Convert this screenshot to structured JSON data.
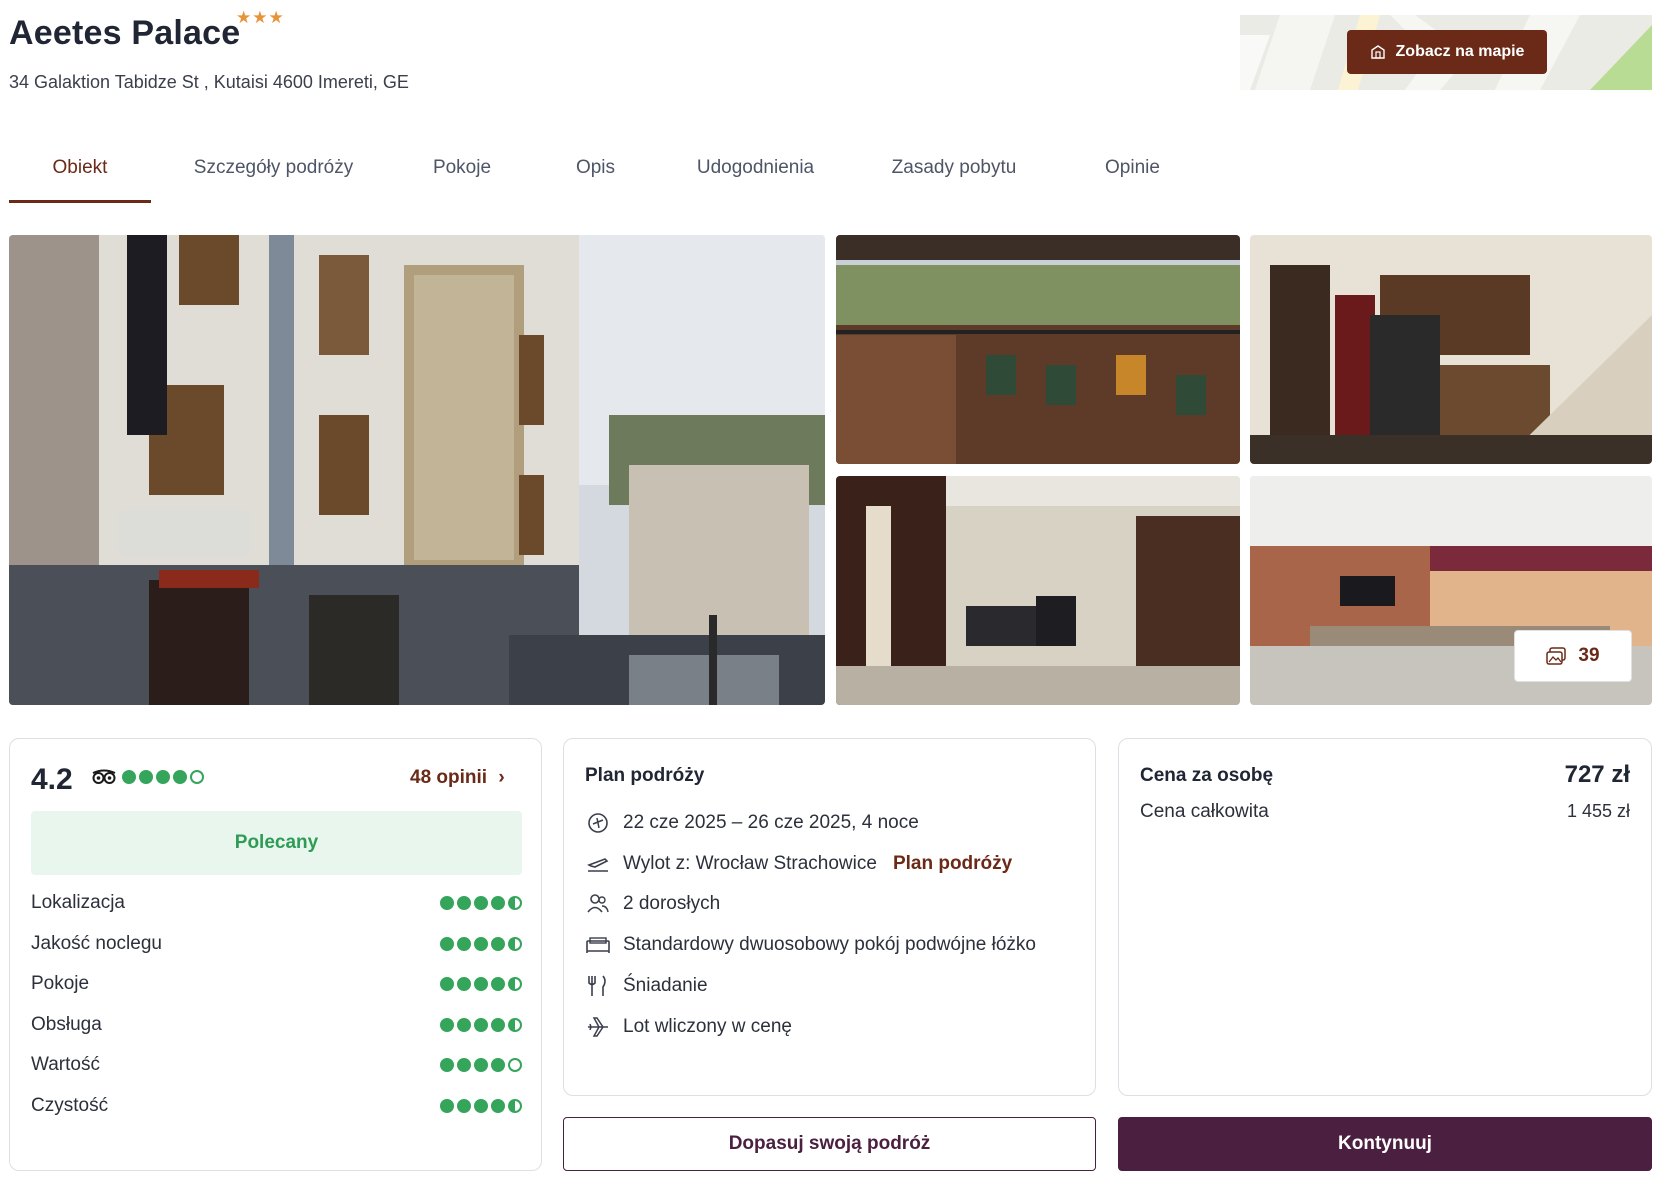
{
  "hotel": {
    "name": "Aeetes Palace",
    "stars": "★★★",
    "address": "34 Galaktion Tabidze St , Kutaisi 4600 Imereti, GE"
  },
  "map": {
    "button_label": "Zobacz na mapie"
  },
  "tabs": [
    {
      "label": "Obiekt",
      "active": true
    },
    {
      "label": "Szczegóły podróży"
    },
    {
      "label": "Pokoje"
    },
    {
      "label": "Opis"
    },
    {
      "label": "Udogodnienia"
    },
    {
      "label": "Zasady pobytu"
    },
    {
      "label": "Opinie"
    }
  ],
  "gallery": {
    "photo_count": "39"
  },
  "rating": {
    "score": "4.2",
    "bubbles": 4,
    "reviews_link": "48 opinii",
    "badge": "Polecany",
    "criteria": [
      {
        "label": "Lokalizacja",
        "value": 4.5
      },
      {
        "label": "Jakość noclegu",
        "value": 4.5
      },
      {
        "label": "Pokoje",
        "value": 4.5
      },
      {
        "label": "Obsługa",
        "value": 4.5
      },
      {
        "label": "Wartość",
        "value": 4
      },
      {
        "label": "Czystość",
        "value": 4.5
      }
    ]
  },
  "plan": {
    "title": "Plan podróży",
    "dates": "22 cze 2025 – 26 cze 2025, 4 noce",
    "departure": "Wylot z: Wrocław Strachowice",
    "departure_link": "Plan podróży",
    "guests": "2 dorosłych",
    "room": "Standardowy dwuosobowy pokój podwójne łóżko",
    "board": "Śniadanie",
    "flight": "Lot wliczony w cenę"
  },
  "price": {
    "per_person_label": "Cena za osobę",
    "per_person_value": "727 zł",
    "total_label": "Cena całkowita",
    "total_value": "1 455 zł"
  },
  "actions": {
    "customize": "Dopasuj swoją podróż",
    "continue": "Kontynuuj"
  },
  "colors": {
    "brand": "#6a2a17",
    "primary_button": "#4a1f3f",
    "rating_green": "#34a55a",
    "star": "#e7933a"
  }
}
